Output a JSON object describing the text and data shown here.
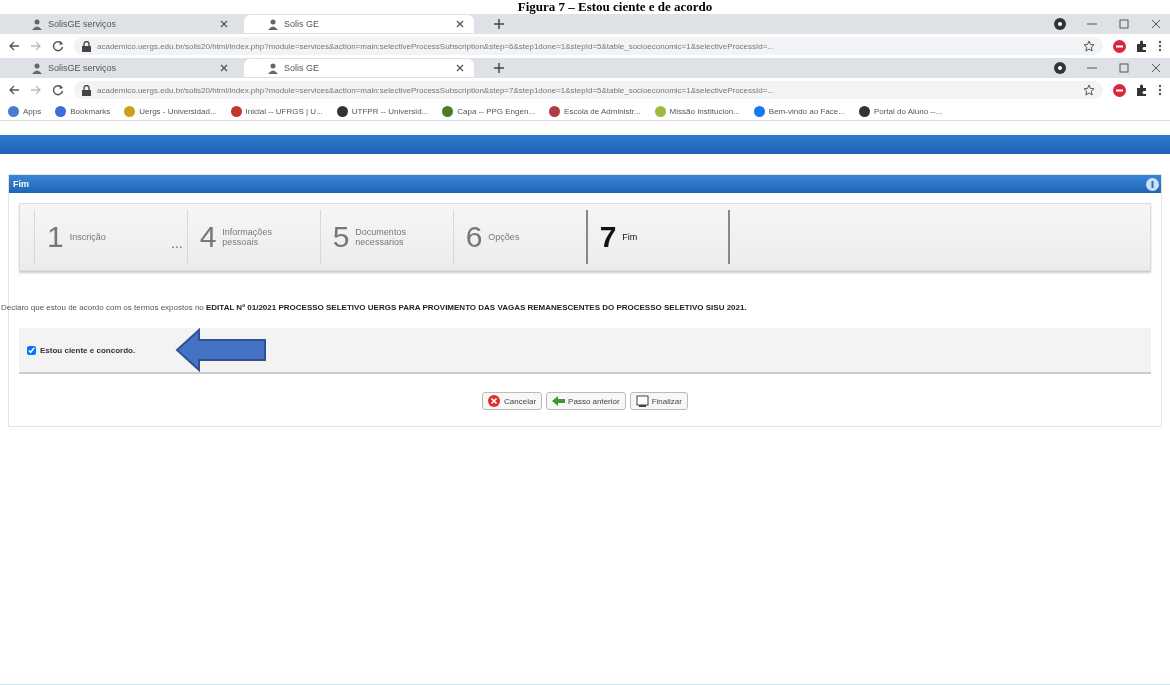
{
  "caption": "Figura 7 – Estou ciente e de acordo",
  "browsers": [
    {
      "tabs": [
        {
          "label": "SolisGE serviços",
          "selected": false
        },
        {
          "label": "Solis GE",
          "selected": true
        }
      ],
      "url": "academico.uergs.edu.br/solis20/html/index.php?module=services&action=main:selectiveProcessSubscription&step=6&step1done=1&stepId=5&table_socioeconomic=1&selectiveProcessId=..."
    },
    {
      "tabs": [
        {
          "label": "SolisGE serviços",
          "selected": false
        },
        {
          "label": "Solis GE",
          "selected": true
        }
      ],
      "url": "academico.uergs.edu.br/solis20/html/index.php?module=services&action=main:selectiveProcessSubscription&step=7&step1done=1&stepId=5&table_socioeconomic=1&selectiveProcessId=..."
    }
  ],
  "bookmarks": [
    {
      "label": "Apps",
      "color": "#4a7bd0"
    },
    {
      "label": "Bookmarks",
      "color": "#3b6fd8"
    },
    {
      "label": "Uergs - Universidad...",
      "color": "#c9a21b"
    },
    {
      "label": "Inicial -- UFRGS | U...",
      "color": "#c0392b"
    },
    {
      "label": "UTFPR -- Universid...",
      "color": "#333333"
    },
    {
      "label": "Capa -- PPG Engen...",
      "color": "#4d7a2a"
    },
    {
      "label": "Escola de Administr...",
      "color": "#b03a48"
    },
    {
      "label": "Missão Institucion...",
      "color": "#9bbb3a"
    },
    {
      "label": "Bem-vindo ao Face...",
      "color": "#1877f2"
    },
    {
      "label": "Portal do Aluno --...",
      "color": "#333333"
    }
  ],
  "panel": {
    "title": "Fim",
    "steps": [
      {
        "number": "1",
        "label": "Inscrição",
        "selected": false
      },
      {
        "number": "4",
        "label": "Informações pessoais",
        "selected": false,
        "gap_before": "..."
      },
      {
        "number": "5",
        "label": "Documentos necessarios",
        "selected": false
      },
      {
        "number": "6",
        "label": "Opções",
        "selected": false
      },
      {
        "number": "7",
        "label": "Fim",
        "selected": true
      }
    ],
    "declaration": "Declaro que estou de acordo com os termos expostos no **EDITAL Nº 01/2021 PROCESSO SELETIVO UERGS PARA PROVIMENTO DAS VAGAS REMANESCENTES DO PROCESSO SELETIVO SISU 2021.**",
    "agree": {
      "label": "Estou ciente e concordo.",
      "checked": true
    },
    "buttons": [
      {
        "label": "Cancelar",
        "kind": "cancel"
      },
      {
        "label": "Passo anterior",
        "kind": "back"
      },
      {
        "label": "Finalizar",
        "kind": "finish"
      }
    ]
  }
}
